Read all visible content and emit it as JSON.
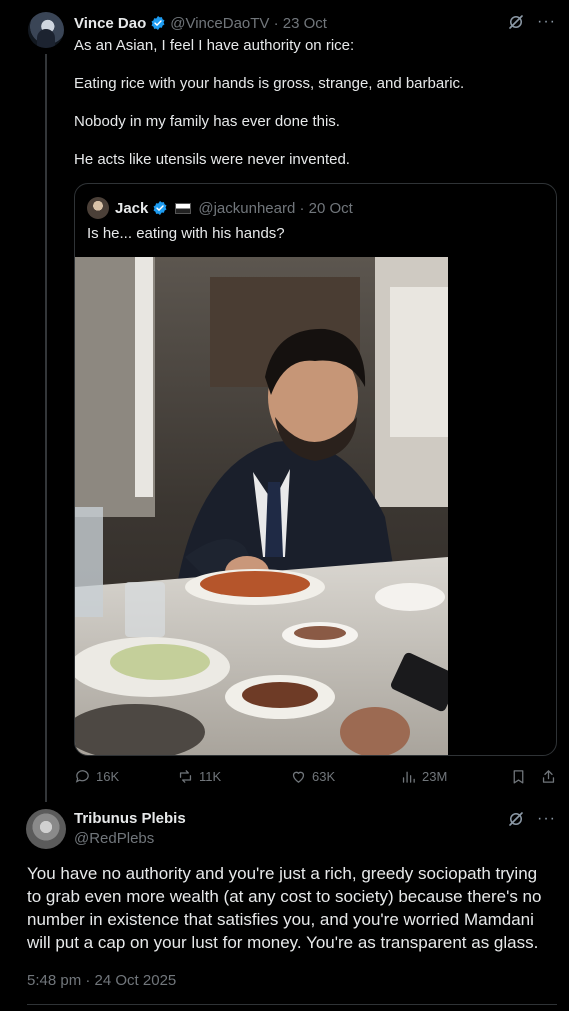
{
  "tweet1": {
    "author_name": "Vince Dao",
    "handle_date": "@VinceDaoTV · 23 Oct",
    "paragraphs": [
      "As an Asian, I feel I have authority on rice:",
      "Eating rice with your hands is gross, strange, and barbaric.",
      "Nobody in my family has ever done this.",
      "He acts like utensils were never invented."
    ],
    "quote": {
      "author_name": "Jack",
      "handle_date": "@jackunheard · 20 Oct",
      "text": "Is he... eating with his hands?"
    },
    "stats": {
      "replies": "16K",
      "reposts": "11K",
      "likes": "63K",
      "views": "23M"
    }
  },
  "tweet2": {
    "author_name": "Tribunus Plebis",
    "handle": "@RedPlebs",
    "text": "You have no authority and you're just a rich, greedy sociopath trying to grab even more wealth (at any cost to society) because there's no number in existence that satisfies you, and you're worried Mamdani will put a cap on your lust for money. You're as transparent as glass.",
    "timestamp": "5:48 pm · 24 Oct 2025"
  },
  "icons": {
    "verified": "verified-badge-icon",
    "grok": "grok-icon",
    "more": "more-icon",
    "reply": "reply-icon",
    "repost": "repost-icon",
    "like": "like-icon",
    "views": "views-icon",
    "bookmark": "bookmark-icon",
    "share": "share-icon"
  },
  "colors": {
    "background": "#000000",
    "text": "#e7e9ea",
    "muted": "#71767b",
    "verified": "#1d9bf0",
    "border": "#2f3336"
  }
}
